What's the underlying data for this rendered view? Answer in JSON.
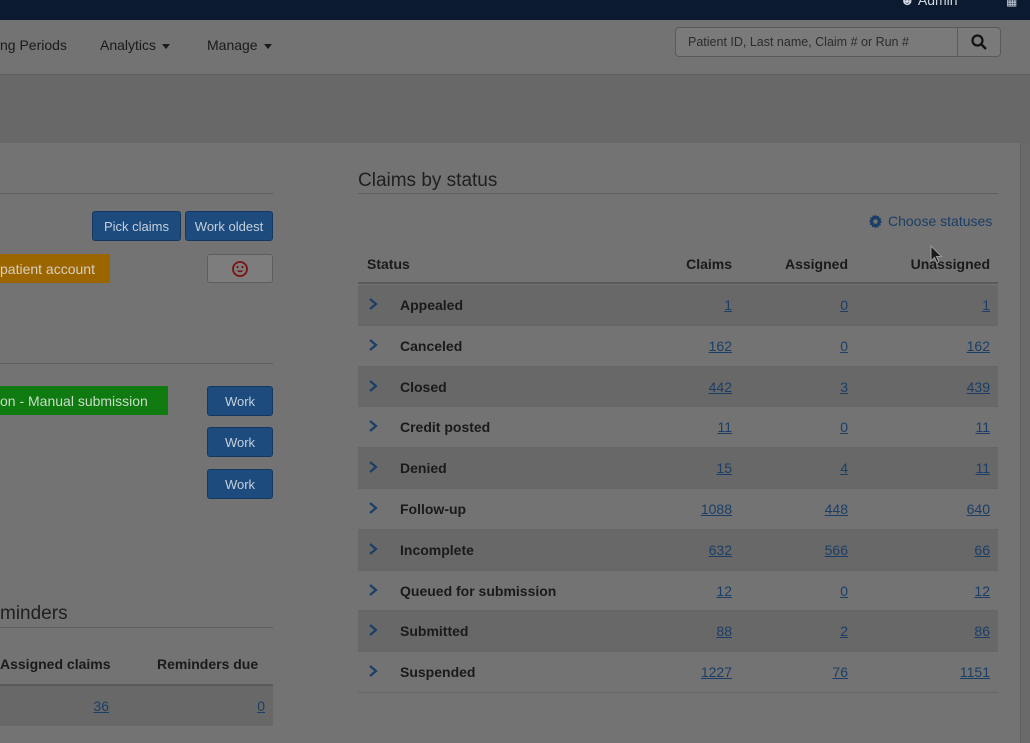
{
  "topbar": {
    "user_label": "Admin"
  },
  "nav": {
    "items": [
      {
        "label": "ng Periods"
      },
      {
        "label": "Analytics"
      },
      {
        "label": "Manage"
      }
    ],
    "search_placeholder": "Patient ID, Last name, Claim # or Run #"
  },
  "left": {
    "pick_claims": "Pick claims",
    "work_oldest": "Work oldest",
    "orange_label": "patient account",
    "green_label": "on - Manual submission",
    "work_buttons": [
      "Work",
      "Work",
      "Work"
    ],
    "reminders_heading": "minders",
    "reminders_table": {
      "headers": [
        "Assigned claims",
        "Reminders due"
      ],
      "row": [
        "36",
        "0"
      ]
    }
  },
  "claims": {
    "title": "Claims by status",
    "choose_statuses": "Choose statuses",
    "headers": {
      "status": "Status",
      "claims": "Claims",
      "assigned": "Assigned",
      "unassigned": "Unassigned"
    },
    "rows": [
      {
        "status": "Appealed",
        "claims": "1",
        "assigned": "0",
        "unassigned": "1"
      },
      {
        "status": "Canceled",
        "claims": "162",
        "assigned": "0",
        "unassigned": "162"
      },
      {
        "status": "Closed",
        "claims": "442",
        "assigned": "3",
        "unassigned": "439"
      },
      {
        "status": "Credit posted",
        "claims": "11",
        "assigned": "0",
        "unassigned": "11"
      },
      {
        "status": "Denied",
        "claims": "15",
        "assigned": "4",
        "unassigned": "11"
      },
      {
        "status": "Follow-up",
        "claims": "1088",
        "assigned": "448",
        "unassigned": "640"
      },
      {
        "status": "Incomplete",
        "claims": "632",
        "assigned": "566",
        "unassigned": "66"
      },
      {
        "status": "Queued for submission",
        "claims": "12",
        "assigned": "0",
        "unassigned": "12"
      },
      {
        "status": "Submitted",
        "claims": "88",
        "assigned": "2",
        "unassigned": "86"
      },
      {
        "status": "Suspended",
        "claims": "1227",
        "assigned": "76",
        "unassigned": "1151"
      }
    ]
  },
  "colors": {
    "primary": "#1d4b7e",
    "warning": "#9b6600",
    "success": "#0f7a0f",
    "link": "#1b3e66"
  }
}
